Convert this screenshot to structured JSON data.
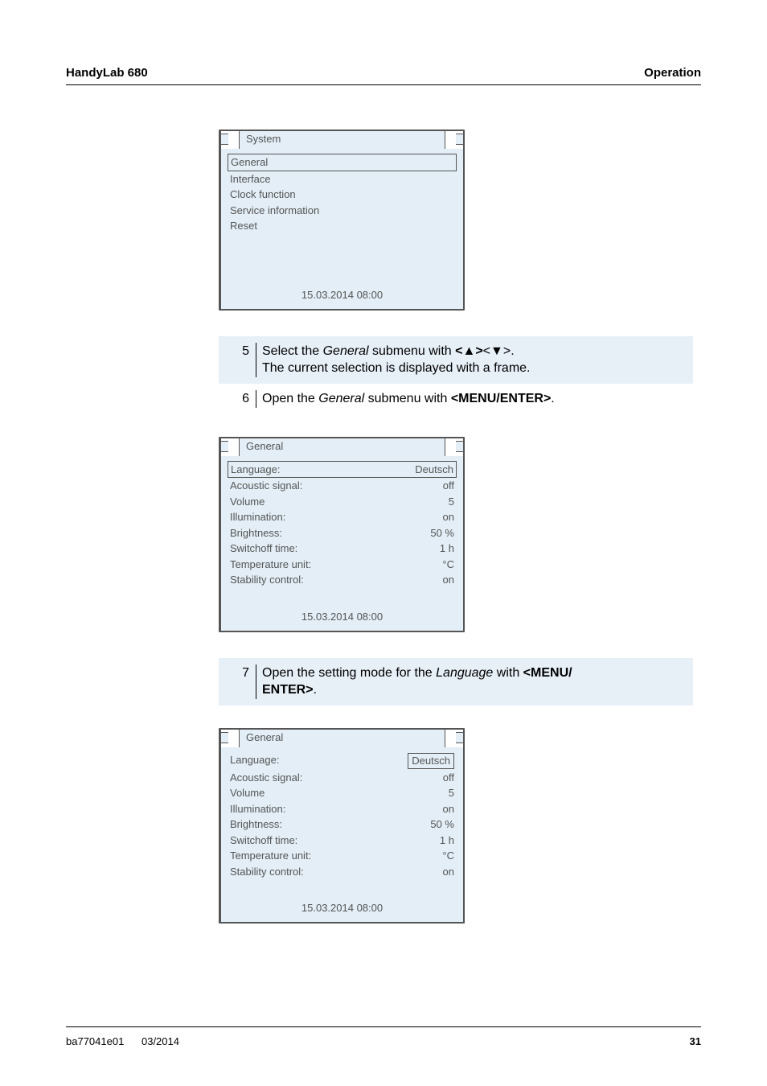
{
  "header": {
    "left": "HandyLab 680",
    "right": "Operation"
  },
  "screen1": {
    "tab": "System",
    "items": [
      "General",
      "Interface",
      "Clock function",
      "Service information",
      "Reset"
    ],
    "selected_index": 0,
    "timestamp": "15.03.2014 08:00"
  },
  "steps_a": [
    {
      "num": "5",
      "html": "Select the <i>General</i> submenu with <b>&lt;▲&gt;</b>&lt;<b>▼</b>&gt;.<br>The current selection is displayed with a frame."
    },
    {
      "num": "6",
      "html": "Open the <i>General</i> submenu with <b>&lt;MENU/ENTER&gt;</b>."
    }
  ],
  "screen2": {
    "tab": "General",
    "rows": [
      {
        "label": "Language:",
        "value": "Deutsch",
        "selected": true
      },
      {
        "label": "Acoustic signal:",
        "value": "off"
      },
      {
        "label": "Volume",
        "value": "5"
      },
      {
        "label": "Illumination:",
        "value": "on"
      },
      {
        "label": "Brightness:",
        "value": "50 %"
      },
      {
        "label": "Switchoff time:",
        "value": "1 h"
      },
      {
        "label": "Temperature unit:",
        "value": "°C"
      },
      {
        "label": "Stability control:",
        "value": "on"
      }
    ],
    "timestamp": "15.03.2014 08:00"
  },
  "steps_b": [
    {
      "num": "7",
      "html": "Open the setting mode for the <i>Language</i> with <b>&lt;MENU/<br>ENTER&gt;</b>."
    }
  ],
  "screen3": {
    "tab": "General",
    "rows": [
      {
        "label": "Language:",
        "value": "Deutsch",
        "value_selected": true
      },
      {
        "label": "Acoustic signal:",
        "value": "off"
      },
      {
        "label": "Volume",
        "value": "5"
      },
      {
        "label": "Illumination:",
        "value": "on"
      },
      {
        "label": "Brightness:",
        "value": "50 %"
      },
      {
        "label": "Switchoff time:",
        "value": "1 h"
      },
      {
        "label": "Temperature unit:",
        "value": "°C"
      },
      {
        "label": "Stability control:",
        "value": "on"
      }
    ],
    "timestamp": "15.03.2014 08:00"
  },
  "footer": {
    "doc": "ba77041e01",
    "date": "03/2014",
    "page": "31"
  }
}
